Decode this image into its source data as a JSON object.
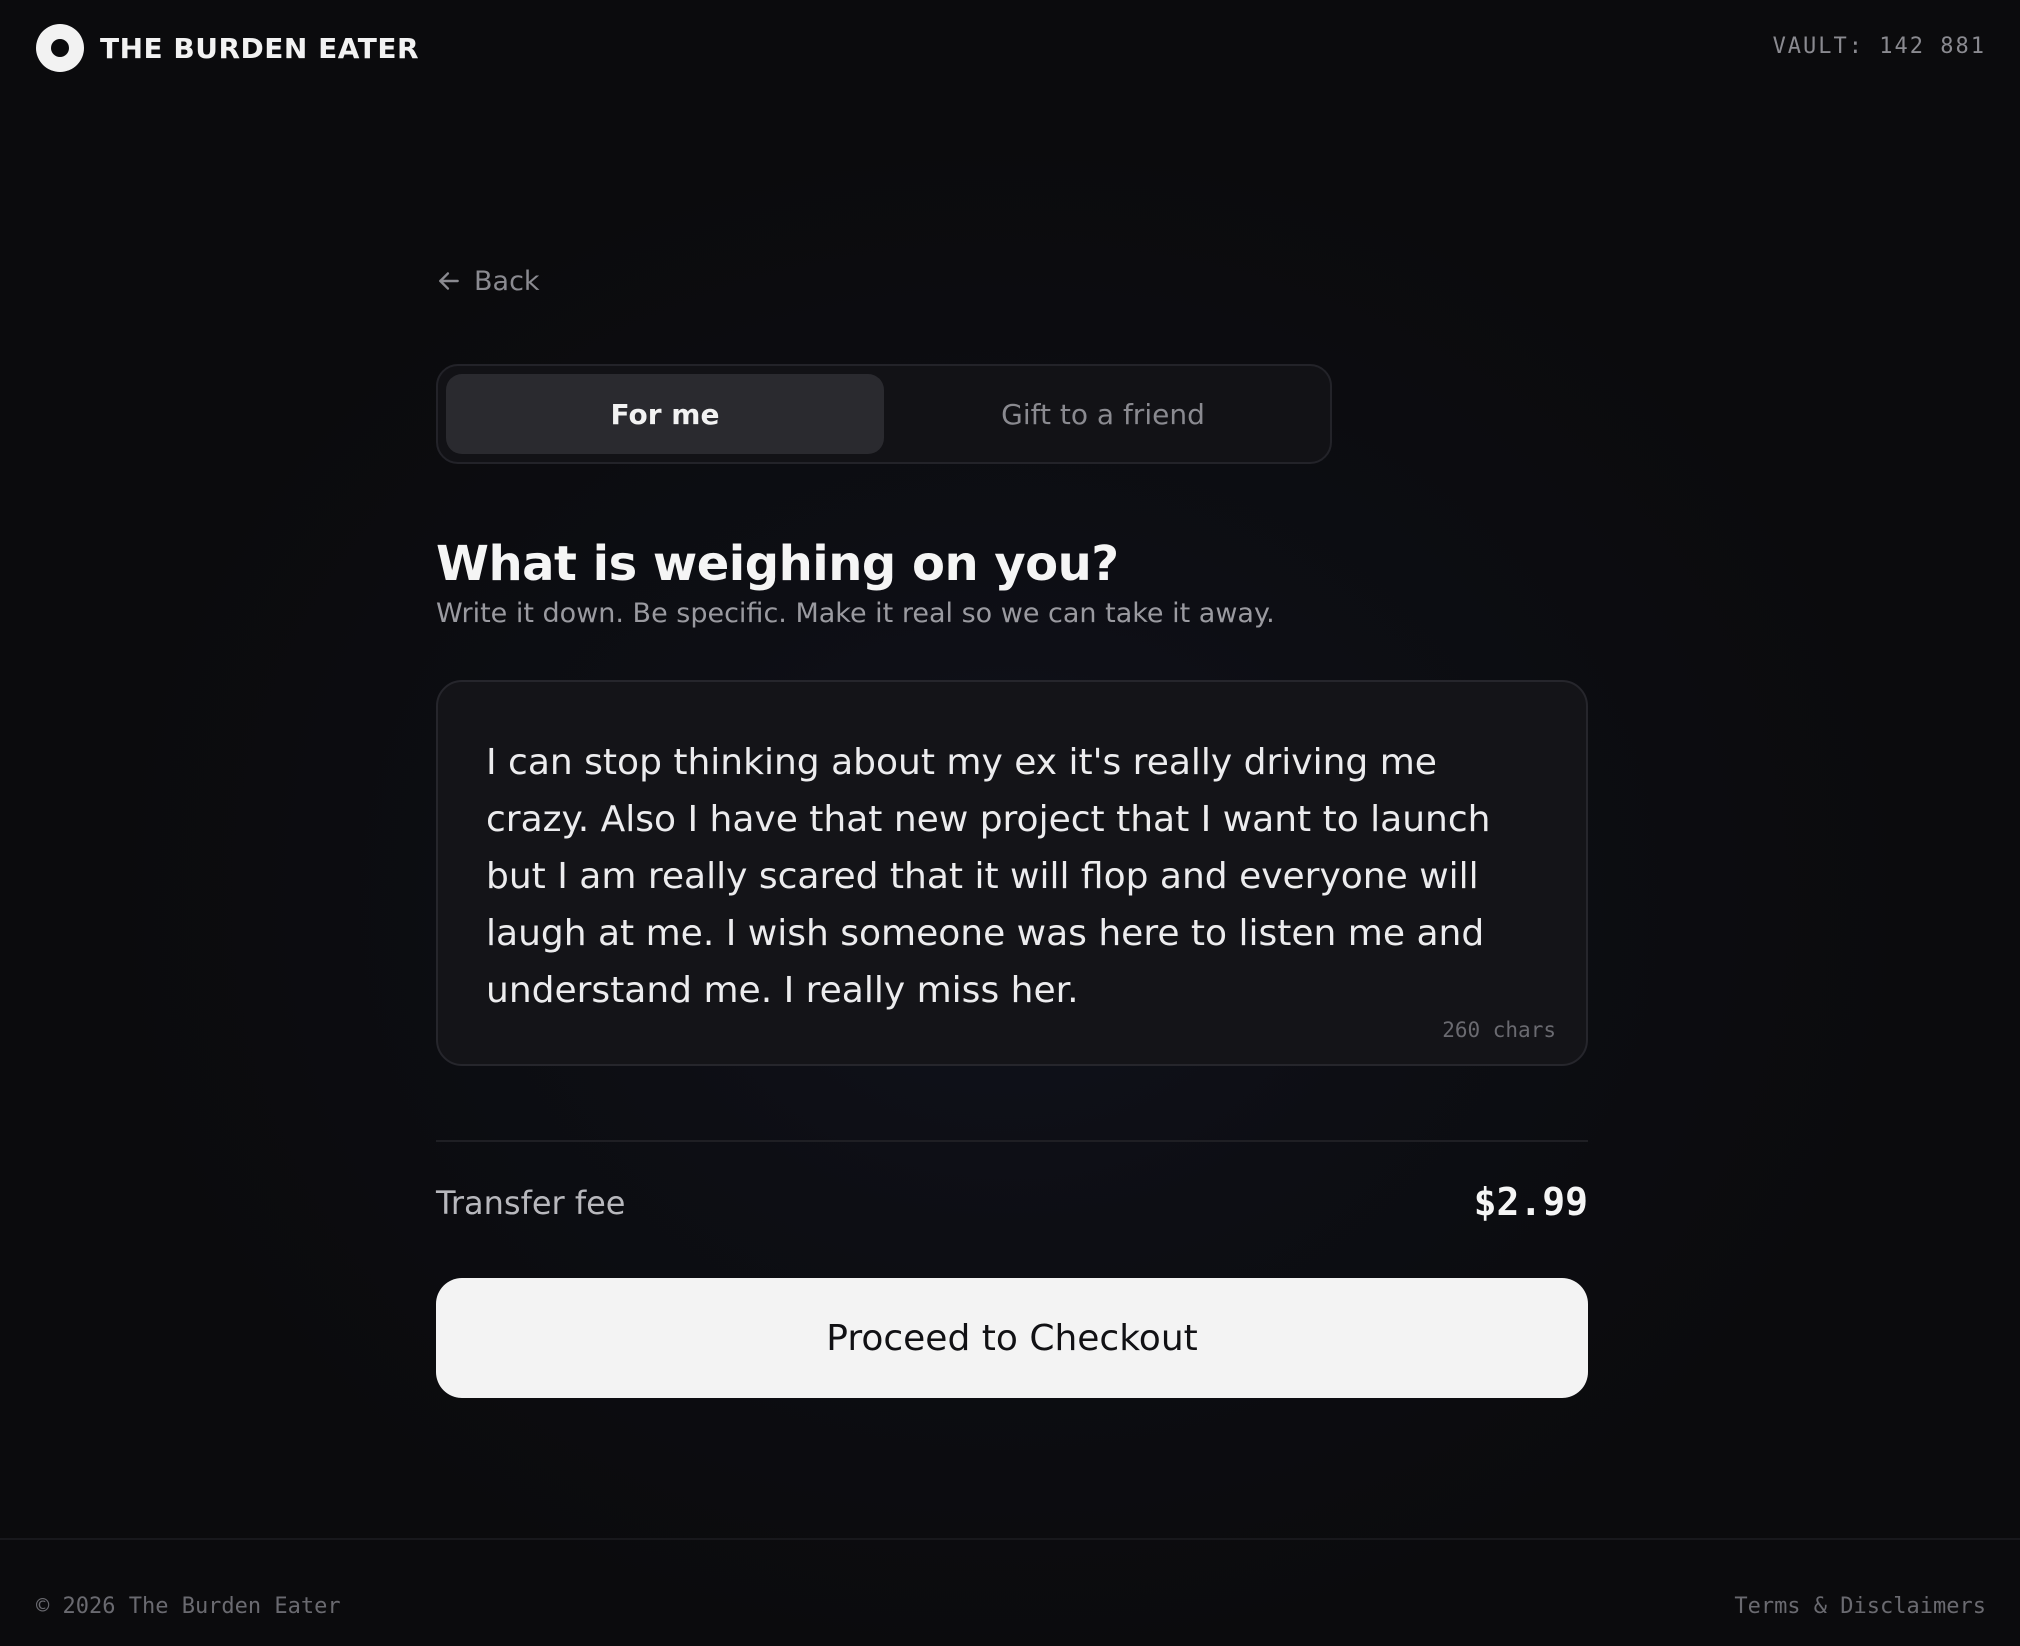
{
  "header": {
    "brand": "THE BURDEN EATER",
    "vault": "VAULT: 142 881"
  },
  "nav": {
    "back_label": "Back"
  },
  "toggle": {
    "options": [
      "For me",
      "Gift to a friend"
    ],
    "selected": "For me"
  },
  "form": {
    "title": "What is weighing on you?",
    "subtitle": "Write it down. Be specific. Make it real so we can take it away.",
    "burden_text": "I can stop thinking about my ex it's really driving me crazy. Also I have that new project that I want to launch but I am really scared that it will flop and everyone will laugh at me. I wish someone was here to listen me and understand me. I really miss her.",
    "char_count": "260 chars"
  },
  "summary": {
    "fee_label": "Transfer fee",
    "fee_value": "$2.99"
  },
  "actions": {
    "checkout_label": "Proceed to Checkout"
  },
  "footer": {
    "copyright": "© 2026 The Burden Eater",
    "terms": "Terms & Disclaimers"
  },
  "colors": {
    "background": "#0b0b0d",
    "button_bg": "#f3f3f3",
    "muted_text": "#8a8a90"
  },
  "icons": {
    "logo": "ring-logo-icon",
    "back": "arrow-left-icon"
  }
}
